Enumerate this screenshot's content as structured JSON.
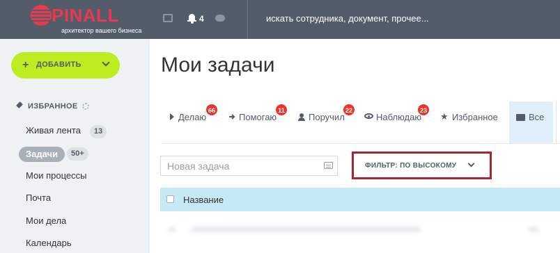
{
  "brand": {
    "name": "PINALL",
    "tagline": "архитектор вашего бизнеса",
    "color": "#e8394f"
  },
  "header": {
    "notifications_count": "4",
    "search_text": "искать сотрудника, документ, прочее...",
    "icons": [
      "chat-icon",
      "bell-icon",
      "cloud-icon"
    ]
  },
  "sidebar": {
    "add_button": {
      "plus": "+",
      "label": "ДОБАВИТЬ",
      "color": "#bbed21"
    },
    "favorites_label": "ИЗБРАННОЕ",
    "items": [
      {
        "label": "Живая лента",
        "badge": "13"
      },
      {
        "label": "Задачи",
        "badge": "50+",
        "active": true
      },
      {
        "label": "Мои процессы"
      },
      {
        "label": "Почта"
      },
      {
        "label": "Мои дела"
      },
      {
        "label": "Календарь"
      }
    ]
  },
  "main": {
    "title": "Мои задачи",
    "tabs": [
      {
        "label": "Делаю",
        "count": "66",
        "icon": "play-icon"
      },
      {
        "label": "Помогаю",
        "count": "11",
        "icon": "arrow-right-icon"
      },
      {
        "label": "Поручил",
        "count": "22",
        "icon": "person-icon"
      },
      {
        "label": "Наблюдаю",
        "count": "23",
        "icon": "eye-icon"
      },
      {
        "label": "Избранное",
        "icon": "star-icon"
      },
      {
        "label": "Все",
        "icon": "envelope-icon",
        "selected": true
      }
    ],
    "new_task_placeholder": "Новая задача",
    "filter_label": "ФИЛЬТР: ПО ВЫСОКОМУ",
    "table": {
      "columns": [
        "Название"
      ]
    },
    "counter_color": "#f0332a",
    "highlight_color": "#a5272d"
  }
}
